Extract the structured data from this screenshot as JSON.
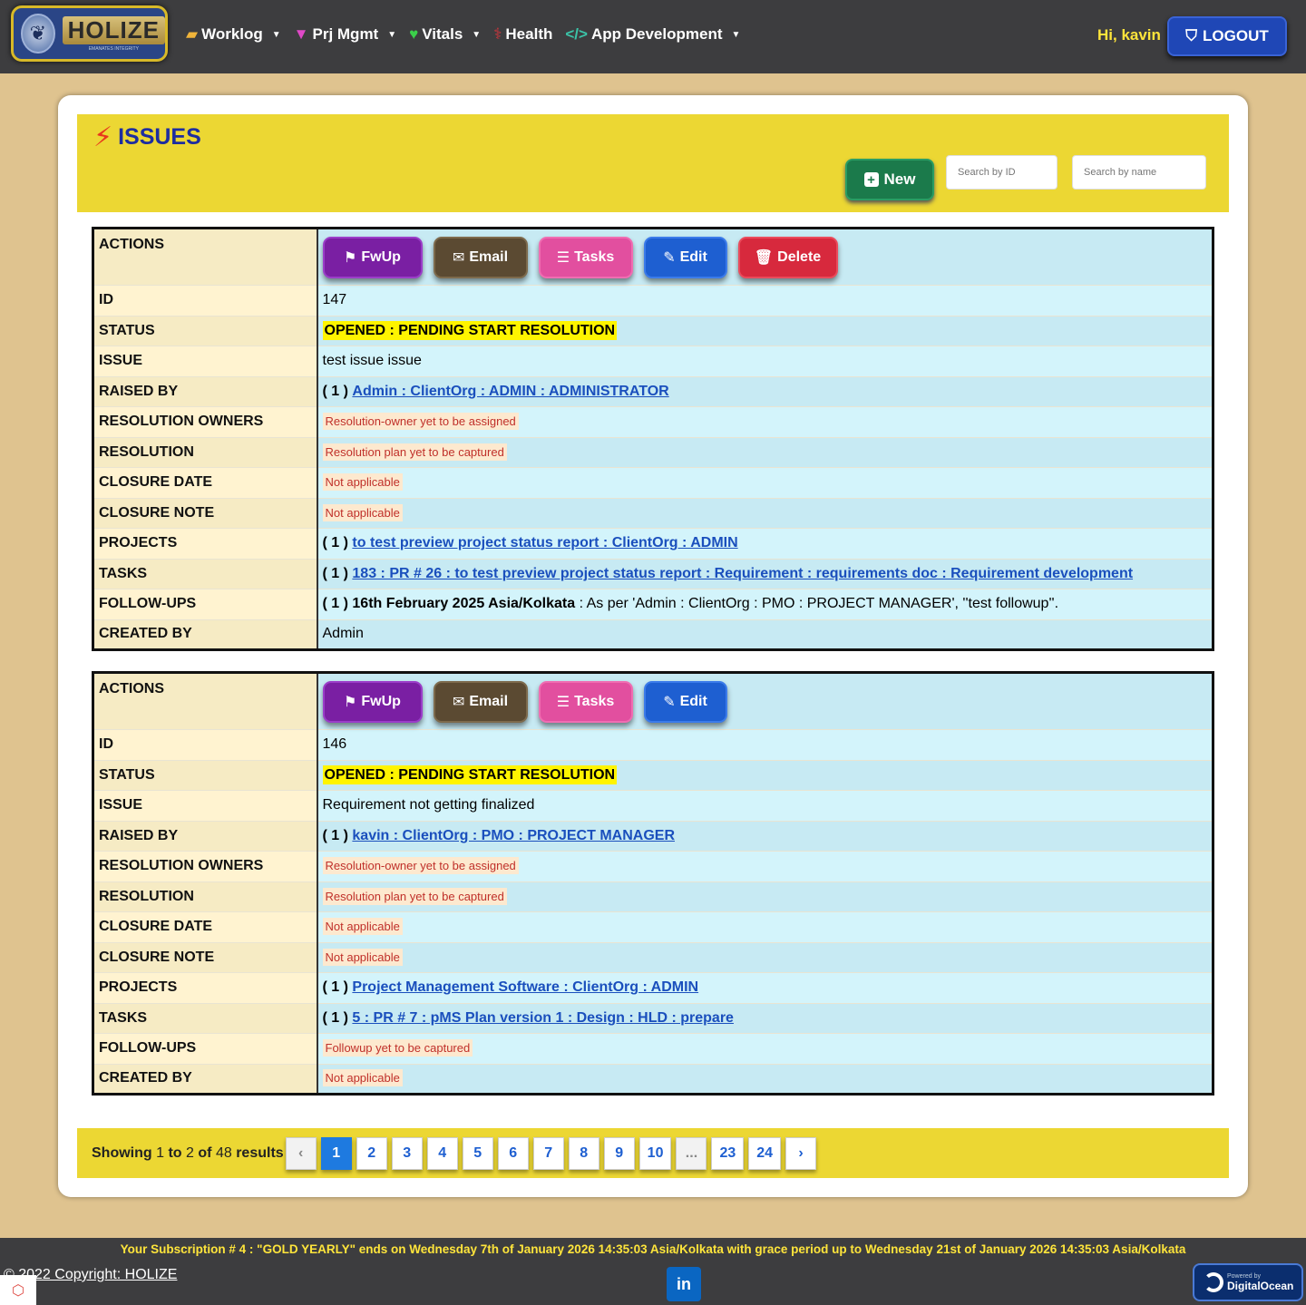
{
  "nav": {
    "logo_text": "HOLIZE",
    "logo_tagline": "EMANATES INTEGRITY",
    "menu": [
      {
        "label": "Worklog",
        "icon": "briefcase-icon",
        "dropdown": true
      },
      {
        "label": "Prj Mgmt",
        "icon": "project-icon",
        "dropdown": true
      },
      {
        "label": "Vitals",
        "icon": "heart-icon",
        "dropdown": true
      },
      {
        "label": "Health",
        "icon": "stethoscope-icon",
        "dropdown": false
      },
      {
        "label": "App Development",
        "icon": "code-icon",
        "dropdown": true
      }
    ],
    "greeting": "Hi, kavin",
    "logout_label": "LOGOUT"
  },
  "header": {
    "title": "ISSUES",
    "new_label": "New",
    "search_id_placeholder": "Search by ID",
    "search_name_placeholder": "Search by name"
  },
  "labels": {
    "actions": "ACTIONS",
    "id": "ID",
    "status": "STATUS",
    "issue": "ISSUE",
    "raised_by": "RAISED BY",
    "resolution_owners": "RESOLUTION OWNERS",
    "resolution": "RESOLUTION",
    "closure_date": "CLOSURE DATE",
    "closure_note": "CLOSURE NOTE",
    "projects": "PROJECTS",
    "tasks": "TASKS",
    "followups": "FOLLOW-UPS",
    "created_by": "CREATED BY"
  },
  "action_labels": {
    "fwup": "FwUp",
    "email": "Email",
    "tasks": "Tasks",
    "edit": "Edit",
    "delete": "Delete"
  },
  "issues": [
    {
      "id": "147",
      "status": "OPENED : PENDING START RESOLUTION",
      "issue": "test issue issue",
      "raised_by_count": "( 1 )",
      "raised_by": "Admin : ClientOrg : ADMIN : ADMINISTRATOR",
      "resolution_owners": "Resolution-owner yet to be assigned",
      "resolution": "Resolution plan yet to be captured",
      "closure_date": "Not applicable",
      "closure_note": "Not applicable",
      "projects_count": "( 1 )",
      "projects": "to test preview project status report : ClientOrg : ADMIN",
      "tasks_count": "( 1 )",
      "tasks": "183 : PR # 26 : to test preview project status report : Requirement : requirements doc : Requirement development",
      "followups_count": "( 1 )",
      "followups_date": "16th February 2025 Asia/Kolkata",
      "followups_text": " : As per 'Admin : ClientOrg : PMO : PROJECT MANAGER', ''test followup''.",
      "created_by": "Admin"
    },
    {
      "id": "146",
      "status": "OPENED : PENDING START RESOLUTION",
      "issue": "Requirement not getting finalized",
      "raised_by_count": "( 1 )",
      "raised_by": "kavin : ClientOrg : PMO : PROJECT MANAGER",
      "resolution_owners": "Resolution-owner yet to be assigned",
      "resolution": "Resolution plan yet to be captured",
      "closure_date": "Not applicable",
      "closure_note": "Not applicable",
      "projects_count": "( 1 )",
      "projects": "Project Management Software : ClientOrg : ADMIN",
      "tasks_count": "( 1 )",
      "tasks": "5 : PR # 7 : pMS Plan version 1 : Design : HLD : prepare",
      "followups": "Followup yet to be captured",
      "created_by": "Not applicable"
    }
  ],
  "pagination": {
    "showing": "Showing",
    "from": "1",
    "to_word": "to",
    "to": "2",
    "of_word": "of",
    "total": "48",
    "results_word": "results",
    "prev": "‹",
    "next": "›",
    "pages": [
      "1",
      "2",
      "3",
      "4",
      "5",
      "6",
      "7",
      "8",
      "9",
      "10",
      "...",
      "23",
      "24"
    ],
    "current": "1"
  },
  "footer": {
    "subscription": "Your Subscription # 4 : \"GOLD YEARLY\" ends on Wednesday 7th of January 2026 14:35:03 Asia/Kolkata with grace period up to Wednesday 21st of January 2026 14:35:03 Asia/Kolkata",
    "copyright": "© 2022 Copyright: HOLIZE",
    "linkedin": "in",
    "do_powered": "Powered by",
    "do_name": "DigitalOcean"
  }
}
